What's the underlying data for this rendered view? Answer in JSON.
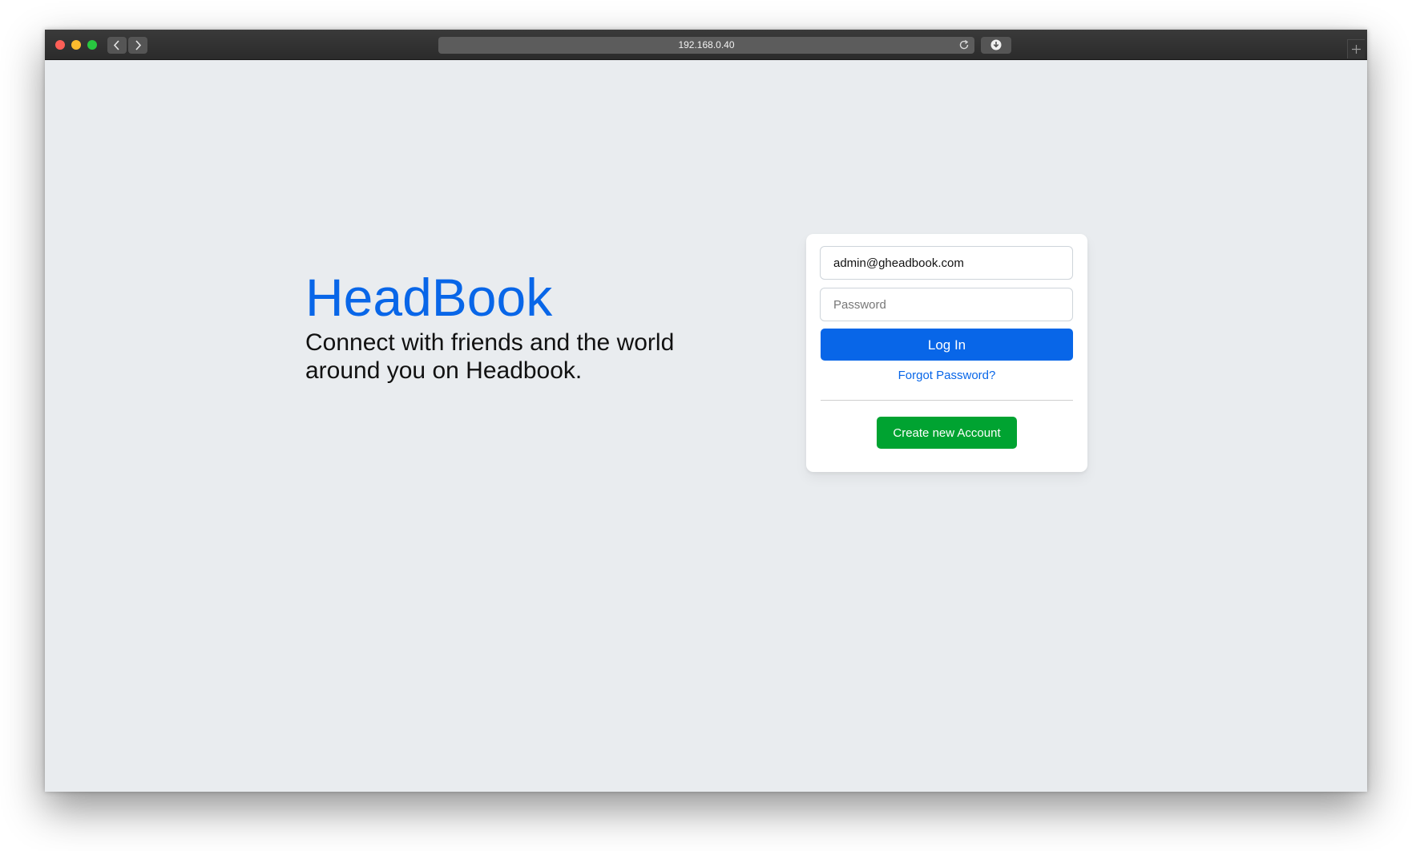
{
  "browser": {
    "url": "192.168.0.40",
    "icons": {
      "back": "chevron-left-icon",
      "forward": "chevron-right-icon",
      "reload": "reload-icon",
      "download": "download-icon",
      "new_tab": "plus-icon"
    }
  },
  "brand": {
    "title": "HeadBook",
    "tagline": "Connect with friends and the world around you on Headbook."
  },
  "login": {
    "email_value": "admin@gheadbook.com",
    "password_placeholder": "Password",
    "login_label": "Log In",
    "forgot_label": "Forgot Password?",
    "create_label": "Create new Account"
  },
  "colors": {
    "brand_blue": "#0866e8",
    "create_green": "#00a331",
    "page_background": "#e9ecef"
  }
}
